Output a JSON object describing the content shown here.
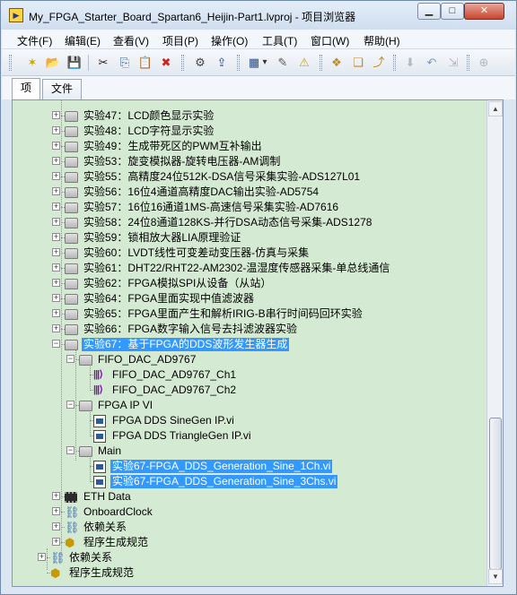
{
  "window": {
    "title": "My_FPGA_Starter_Board_Spartan6_Heijin-Part1.lvproj - 项目浏览器",
    "app_icon": "labview-project-icon",
    "minimize_glyph": "▁",
    "maximize_glyph": "□",
    "close_glyph": "✕"
  },
  "menu": [
    "文件(F)",
    "编辑(E)",
    "查看(V)",
    "项目(P)",
    "操作(O)",
    "工具(T)",
    "窗口(W)",
    "帮助(H)"
  ],
  "toolbar": {
    "new_icon": "✶",
    "open_icon": "📂",
    "save_all_icon": "💾",
    "cut_icon": "✂",
    "copy_icon": "⎘",
    "paste_icon": "📋",
    "delete_icon": "✖",
    "build_icon": "⚙",
    "deploy_icon": "⇪",
    "view_icon": "▦",
    "view_arrow": "▾",
    "wizard_icon": "✎",
    "warning_icon": "⚠",
    "group1_icon": "❖",
    "group2_icon": "❏",
    "group3_icon": "⤴",
    "filter_icon": "⬇",
    "undo_icon": "↶",
    "redo_icon": "⇲",
    "add_icon": "⊕"
  },
  "tabs": {
    "items": "项",
    "files": "文件"
  },
  "tree": {
    "expand_plus": "+",
    "expand_minus": "−",
    "items": [
      {
        "label": "实验47：LCD颜色显示实验"
      },
      {
        "label": "实验48：LCD字符显示实验"
      },
      {
        "label": "实验49：生成带死区的PWM互补输出"
      },
      {
        "label": "实验53：旋变模拟器-旋转电压器-AM调制"
      },
      {
        "label": "实验55：高精度24位512K-DSA信号采集实验-ADS127L01"
      },
      {
        "label": "实验56：16位4通道高精度DAC输出实验-AD5754"
      },
      {
        "label": "实验57：16位16通道1MS-高速信号采集实验-AD7616"
      },
      {
        "label": "实验58：24位8通道128KS-并行DSA动态信号采集-ADS1278"
      },
      {
        "label": "实验59：锁相放大器LIA原理验证"
      },
      {
        "label": "实验60：LVDT线性可变差动变压器-仿真与采集"
      },
      {
        "label": "实验61：DHT22/RHT22-AM2302-温湿度传感器采集-单总线通信"
      },
      {
        "label": "实验62：FPGA模拟SPI从设备（从站）"
      },
      {
        "label": "实验64：FPGA里面实现中值滤波器"
      },
      {
        "label": "实验65：FPGA里面产生和解析IRIG-B串行时间码回环实验"
      },
      {
        "label": "实验66：FPGA数字输入信号去抖滤波器实验"
      },
      {
        "label": "实验67：基于FPGA的DDS波形发生器生成"
      },
      {
        "label": "FIFO_DAC_AD9767"
      },
      {
        "label": "FIFO_DAC_AD9767_Ch1"
      },
      {
        "label": "FIFO_DAC_AD9767_Ch2"
      },
      {
        "label": "FPGA IP VI"
      },
      {
        "label": "FPGA DDS SineGen IP.vi"
      },
      {
        "label": "FPGA DDS TriangleGen IP.vi"
      },
      {
        "label": "Main"
      },
      {
        "label": "实验67-FPGA_DDS_Generation_Sine_1Ch.vi"
      },
      {
        "label": "实验67-FPGA_DDS_Generation_Sine_3Chs.vi"
      },
      {
        "label": "ETH Data"
      },
      {
        "label": "OnboardClock"
      },
      {
        "label": "依赖关系"
      },
      {
        "label": "程序生成规范"
      },
      {
        "label": "依赖关系"
      },
      {
        "label": "程序生成规范"
      }
    ]
  },
  "scrollbar": {
    "up_glyph": "▲",
    "down_glyph": "▼",
    "position_fraction": 0.95
  }
}
